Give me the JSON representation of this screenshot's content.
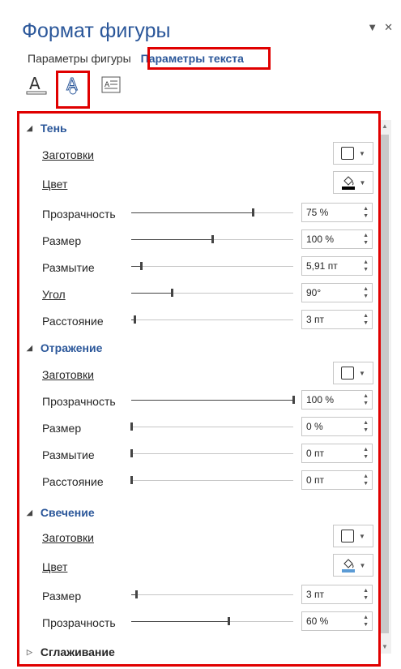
{
  "pane": {
    "title": "Формат фигуры",
    "tabs": [
      "Параметры фигуры",
      "Параметры текста"
    ],
    "active_tab": "Параметры текста",
    "colors": {
      "accent": "#2b579a",
      "highlight": "#e00000"
    }
  },
  "icons": [
    "text-fill-icon",
    "text-effects-icon",
    "textbox-icon"
  ],
  "shadow": {
    "title": "Тень",
    "presets_label": "Заготовки",
    "color_label": "Цвет",
    "color_value": "#000000",
    "transparency": {
      "label": "Прозрачность",
      "value": "75 %"
    },
    "size": {
      "label": "Размер",
      "value": "100 %"
    },
    "blur": {
      "label": "Размытие",
      "value": "5,91 пт"
    },
    "angle": {
      "label": "Угол",
      "value": "90°"
    },
    "distance": {
      "label": "Расстояние",
      "value": "3 пт"
    }
  },
  "reflection": {
    "title": "Отражение",
    "presets_label": "Заготовки",
    "transparency": {
      "label": "Прозрачность",
      "value": "100 %"
    },
    "size": {
      "label": "Размер",
      "value": "0 %"
    },
    "blur": {
      "label": "Размытие",
      "value": "0 пт"
    },
    "distance": {
      "label": "Расстояние",
      "value": "0 пт"
    }
  },
  "glow": {
    "title": "Свечение",
    "presets_label": "Заготовки",
    "color_label": "Цвет",
    "color_value": "#5b9bd5",
    "size": {
      "label": "Размер",
      "value": "3 пт"
    },
    "transparency": {
      "label": "Прозрачность",
      "value": "60 %"
    }
  },
  "soft_edges": {
    "title": "Сглаживание"
  },
  "slider_levels": {
    "shadow_transparency": 0.75,
    "shadow_size": 0.5,
    "shadow_blur": 0.06,
    "shadow_angle": 0.25,
    "shadow_distance": 0.02,
    "reflection_transparency": 1.0,
    "reflection_size": 0.0,
    "reflection_blur": 0.0,
    "reflection_distance": 0.0,
    "glow_size": 0.03,
    "glow_transparency": 0.6
  }
}
